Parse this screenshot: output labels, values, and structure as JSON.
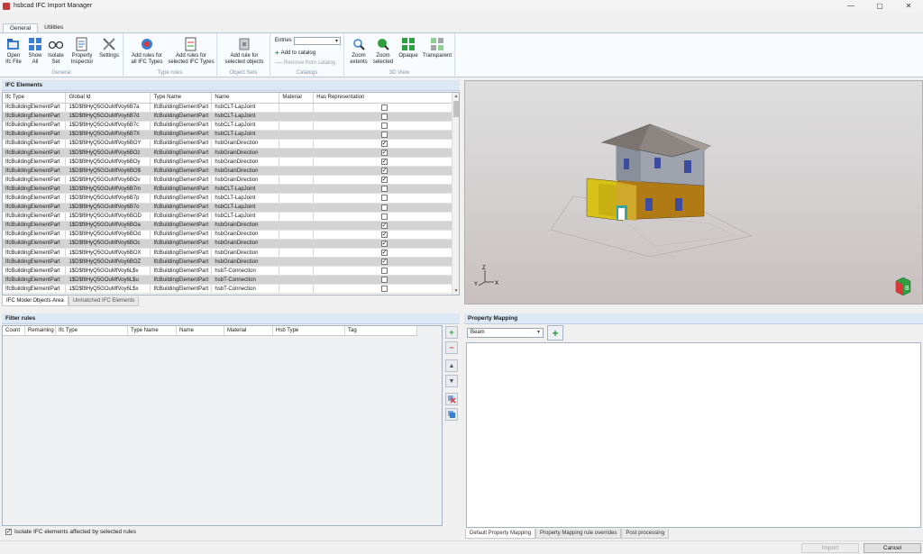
{
  "window": {
    "title": "hsbcad IFC Import Manager",
    "minimize": "—",
    "maximize": "▢",
    "close": "✕"
  },
  "ribbon": {
    "tabs": [
      "General",
      "Utilities"
    ],
    "groups": {
      "general": "General",
      "type_rules": "Type rules",
      "object_sets": "Object Sets",
      "catalogs": "Catalogs",
      "view3d": "3D View"
    },
    "buttons": {
      "open_ifc": [
        "Open",
        "Ifc File"
      ],
      "show_all": [
        "Show",
        "All"
      ],
      "isolate_set": [
        "Isolate",
        "Set"
      ],
      "property_inspector": [
        "Property",
        "Inspector"
      ],
      "settings": [
        "Settings"
      ],
      "add_rules_all": [
        "Add rules for",
        "all IFC Types"
      ],
      "add_rules_selected": [
        "Add rules for",
        "selected IFC Types"
      ],
      "add_rule_objects": [
        "Add rule for",
        "selected objects"
      ],
      "zoom_extents": [
        "Zoom",
        "extents"
      ],
      "zoom_selected": [
        "Zoom",
        "selected"
      ],
      "opaque": [
        "Opaque"
      ],
      "transparent": [
        "Transparent"
      ]
    },
    "catalog": {
      "entries_label": "Entries",
      "entries_value": "",
      "add": "Add to catalog",
      "remove": "Remove from catalog"
    }
  },
  "ifc_elements": {
    "title": "IFC Elements",
    "columns": [
      "Ifc Type",
      "Global Id",
      "Type Name",
      "Name",
      "Material",
      "Has Representation"
    ],
    "rows": [
      {
        "ifc_type": "IfcBuildingElementPart",
        "global_id": "1$D$f8HyQ5GOuMfVoy6B7a",
        "type_name": "IfcBuildingElementPart",
        "name": "hsbCLT-LapJoint",
        "material": "",
        "has_rep": false
      },
      {
        "ifc_type": "IfcBuildingElementPart",
        "global_id": "1$D$f8HyQ5GOuMfVoy6B7d",
        "type_name": "IfcBuildingElementPart",
        "name": "hsbCLT-LapJoint",
        "material": "",
        "has_rep": false
      },
      {
        "ifc_type": "IfcBuildingElementPart",
        "global_id": "1$D$f8HyQ5GOuMfVoy6B7c",
        "type_name": "IfcBuildingElementPart",
        "name": "hsbCLT-LapJoint",
        "material": "",
        "has_rep": false
      },
      {
        "ifc_type": "IfcBuildingElementPart",
        "global_id": "1$D$f8HyQ5GOuMfVoy6B7X",
        "type_name": "IfcBuildingElementPart",
        "name": "hsbCLT-LapJoint",
        "material": "",
        "has_rep": false
      },
      {
        "ifc_type": "IfcBuildingElementPart",
        "global_id": "1$D$f8HyQ5GOuMfVoy6BOY",
        "type_name": "IfcBuildingElementPart",
        "name": "hsbGrainDirection",
        "material": "",
        "has_rep": true
      },
      {
        "ifc_type": "IfcBuildingElementPart",
        "global_id": "1$D$f8HyQ5GOuMfVoy6BOz",
        "type_name": "IfcBuildingElementPart",
        "name": "hsbGrainDirection",
        "material": "",
        "has_rep": true
      },
      {
        "ifc_type": "IfcBuildingElementPart",
        "global_id": "1$D$f8HyQ5GOuMfVoy6BOy",
        "type_name": "IfcBuildingElementPart",
        "name": "hsbGrainDirection",
        "material": "",
        "has_rep": true
      },
      {
        "ifc_type": "IfcBuildingElementPart",
        "global_id": "1$D$f8HyQ5GOuMfVoy6BO$",
        "type_name": "IfcBuildingElementPart",
        "name": "hsbGrainDirection",
        "material": "",
        "has_rep": true
      },
      {
        "ifc_type": "IfcBuildingElementPart",
        "global_id": "1$D$f8HyQ5GOuMfVoy6BOv",
        "type_name": "IfcBuildingElementPart",
        "name": "hsbGrainDirection",
        "material": "",
        "has_rep": true
      },
      {
        "ifc_type": "IfcBuildingElementPart",
        "global_id": "1$D$f8HyQ5GOuMfVoy6B7m",
        "type_name": "IfcBuildingElementPart",
        "name": "hsbCLT-LapJoint",
        "material": "",
        "has_rep": false
      },
      {
        "ifc_type": "IfcBuildingElementPart",
        "global_id": "1$D$f8HyQ5GOuMfVoy6B7p",
        "type_name": "IfcBuildingElementPart",
        "name": "hsbCLT-LapJoint",
        "material": "",
        "has_rep": false
      },
      {
        "ifc_type": "IfcBuildingElementPart",
        "global_id": "1$D$f8HyQ5GOuMfVoy6B7o",
        "type_name": "IfcBuildingElementPart",
        "name": "hsbCLT-LapJoint",
        "material": "",
        "has_rep": false
      },
      {
        "ifc_type": "IfcBuildingElementPart",
        "global_id": "1$D$f8HyQ5GOuMfVoy6BOD",
        "type_name": "IfcBuildingElementPart",
        "name": "hsbCLT-LapJoint",
        "material": "",
        "has_rep": false
      },
      {
        "ifc_type": "IfcBuildingElementPart",
        "global_id": "1$D$f8HyQ5GOuMfVoy6BOa",
        "type_name": "IfcBuildingElementPart",
        "name": "hsbGrainDirection",
        "material": "",
        "has_rep": true
      },
      {
        "ifc_type": "IfcBuildingElementPart",
        "global_id": "1$D$f8HyQ5GOuMfVoy6BOd",
        "type_name": "IfcBuildingElementPart",
        "name": "hsbGrainDirection",
        "material": "",
        "has_rep": true
      },
      {
        "ifc_type": "IfcBuildingElementPart",
        "global_id": "1$D$f8HyQ5GOuMfVoy6BOc",
        "type_name": "IfcBuildingElementPart",
        "name": "hsbGrainDirection",
        "material": "",
        "has_rep": true
      },
      {
        "ifc_type": "IfcBuildingElementPart",
        "global_id": "1$D$f8HyQ5GOuMfVoy6BOX",
        "type_name": "IfcBuildingElementPart",
        "name": "hsbGrainDirection",
        "material": "",
        "has_rep": true
      },
      {
        "ifc_type": "IfcBuildingElementPart",
        "global_id": "1$D$f8HyQ5GOuMfVoy6BOZ",
        "type_name": "IfcBuildingElementPart",
        "name": "hsbGrainDirection",
        "material": "",
        "has_rep": true
      },
      {
        "ifc_type": "IfcBuildingElementPart",
        "global_id": "1$D$f8HyQ5GOuMfVoy6L$v",
        "type_name": "IfcBuildingElementPart",
        "name": "hsbT-Connection",
        "material": "",
        "has_rep": false
      },
      {
        "ifc_type": "IfcBuildingElementPart",
        "global_id": "1$D$f8HyQ5GOuMfVoy6L$u",
        "type_name": "IfcBuildingElementPart",
        "name": "hsbT-Connection",
        "material": "",
        "has_rep": false
      },
      {
        "ifc_type": "IfcBuildingElementPart",
        "global_id": "1$D$f8HyQ5GOuMfVoy6L$x",
        "type_name": "IfcBuildingElementPart",
        "name": "hsbT-Connection",
        "material": "",
        "has_rep": false
      }
    ],
    "area_tabs": [
      "IFC Model Objects Area",
      "Unmatched IFC Elements"
    ]
  },
  "viewport": {
    "axis_z": "Z",
    "axis_y": "Y",
    "axis_x": "X",
    "viewcube_label": "B"
  },
  "filter_rules": {
    "title": "Filter rules",
    "columns": [
      "Count",
      "Remaining",
      "Ifc Type",
      "Type Name",
      "Name",
      "Material",
      "Hsb Type",
      "Tag"
    ],
    "isolate_label": "Isolate IFC elements affected by selected rules",
    "isolate_checked": true
  },
  "property_mapping": {
    "title": "Property Mapping",
    "selected_type": "Beam",
    "tabs": [
      "Default Property Mapping",
      "Property Mapping rule overrides",
      "Post processing"
    ]
  },
  "footer": {
    "import": "Import",
    "cancel": "Cancel"
  },
  "colors": {
    "accent_green": "#2e9e3e",
    "accent_red": "#d83a3a",
    "header_blue": "#dde8f5"
  }
}
